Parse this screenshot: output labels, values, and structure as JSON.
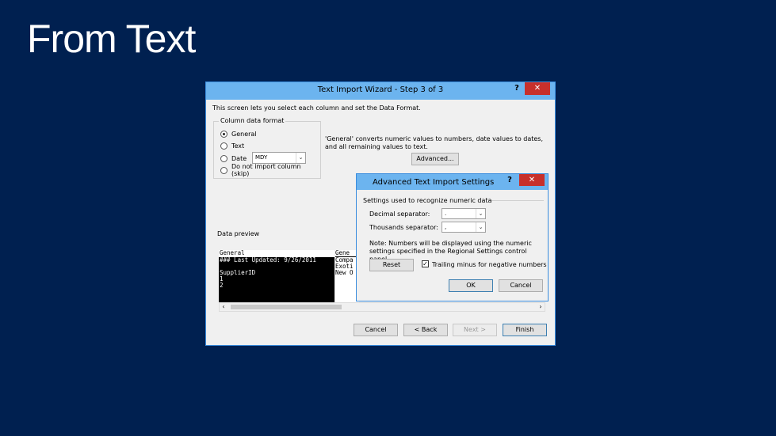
{
  "slide": {
    "title": "From Text"
  },
  "wizard": {
    "title": "Text Import Wizard - Step 3 of 3",
    "help": "?",
    "close": "✕",
    "intro": "This screen lets you select each column and set the Data Format.",
    "column_format": {
      "legend": "Column data format",
      "options": [
        "General",
        "Text",
        "Date",
        "Do not import column (skip)"
      ],
      "selected": "General",
      "date_value": "MDY"
    },
    "description": "'General' converts numeric values to numbers, date values to dates, and all remaining values to text.",
    "advanced_button": "Advanced...",
    "data_preview": {
      "label": "Data preview",
      "left_header": "General",
      "left_rows": [
        "### Last Updated: 9/26/2011",
        "",
        "SupplierID",
        "1",
        "2"
      ],
      "right_header": "Gene",
      "right_rows": [
        "",
        "",
        "Compa",
        "Exoti",
        "New O"
      ]
    },
    "buttons": {
      "cancel": "Cancel",
      "back": "< Back",
      "next": "Next >",
      "finish": "Finish"
    }
  },
  "advanced": {
    "title": "Advanced Text Import Settings",
    "help": "?",
    "close": "✕",
    "section": "Settings used to recognize numeric data",
    "decimal_label": "Decimal separator:",
    "decimal_value": ".",
    "thousands_label": "Thousands separator:",
    "thousands_value": ",",
    "note": "Note: Numbers will be displayed using the numeric settings specified in the Regional Settings control panel.",
    "reset": "Reset",
    "trailing_minus": "Trailing minus for negative numbers",
    "trailing_minus_checked": true,
    "ok": "OK",
    "cancel": "Cancel"
  }
}
